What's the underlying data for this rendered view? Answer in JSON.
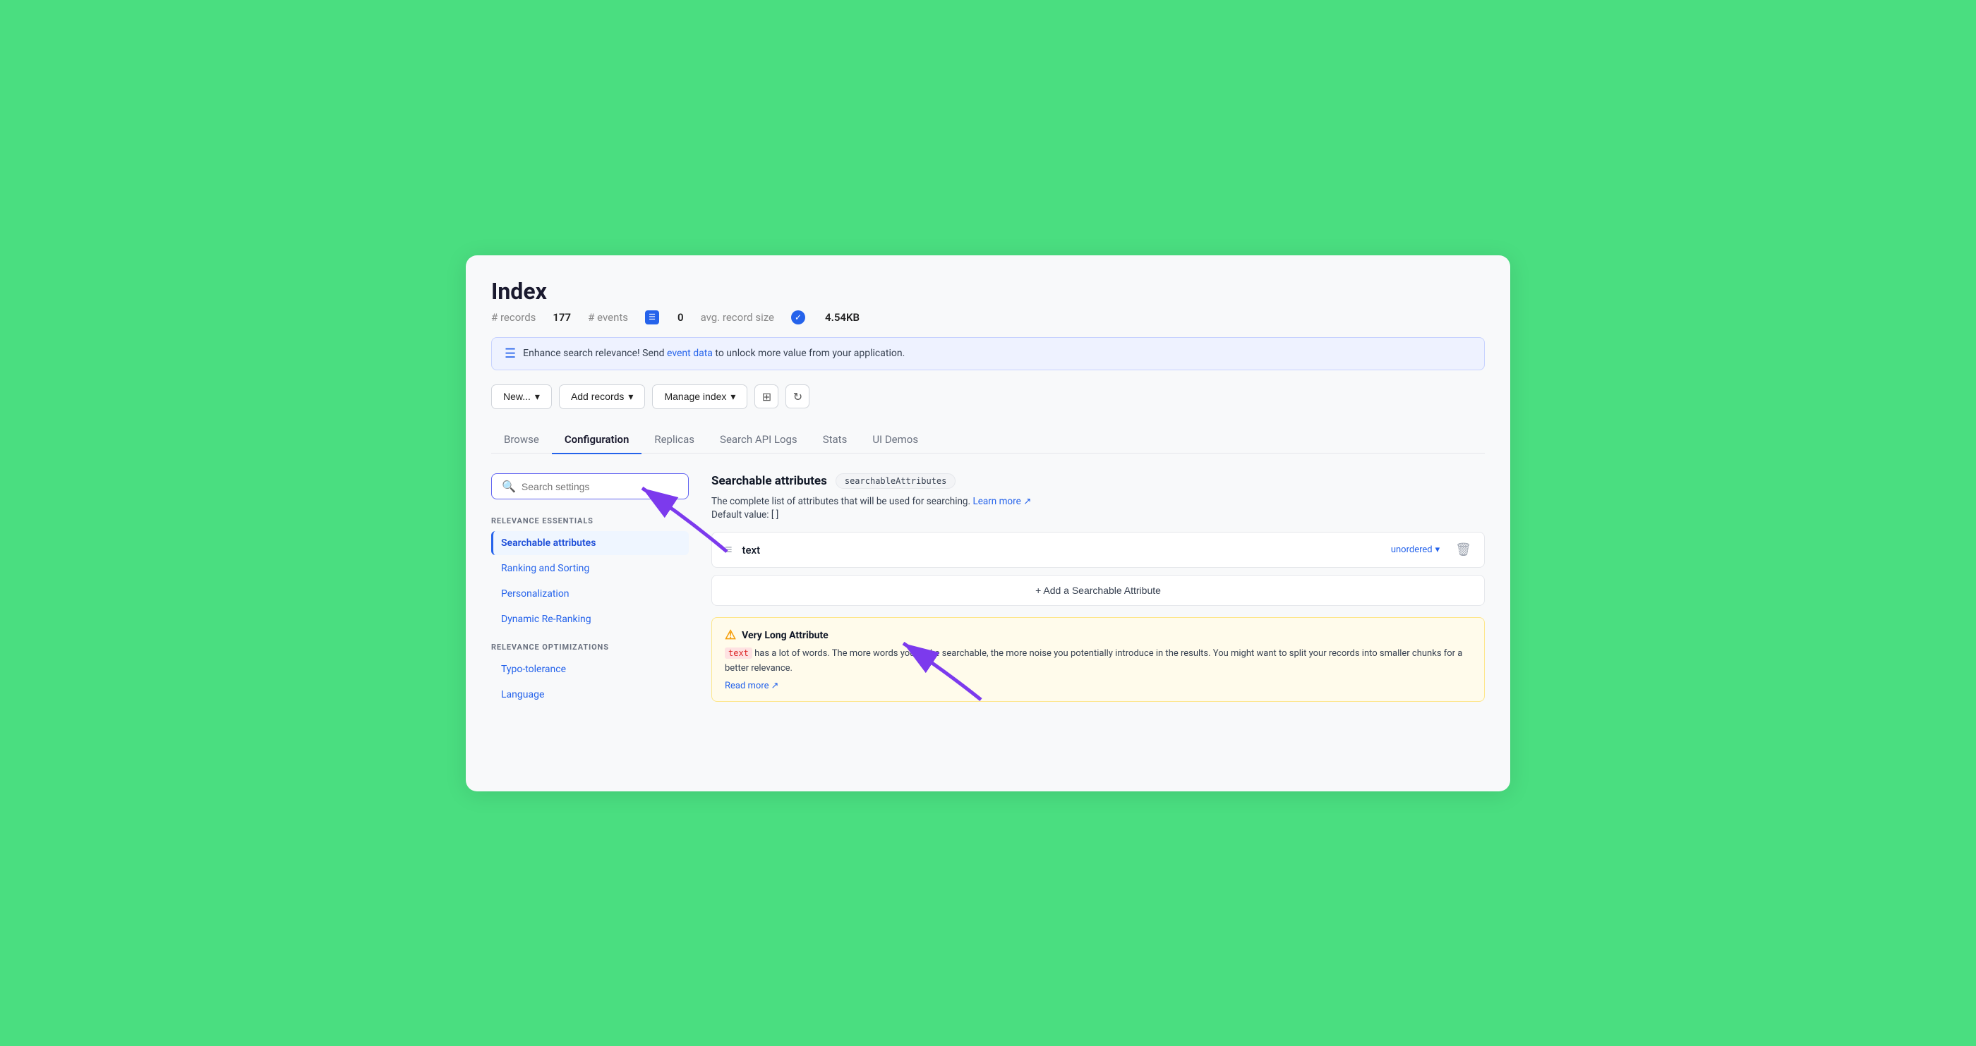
{
  "page": {
    "title": "Index"
  },
  "stats": {
    "records_label": "# records",
    "records_value": "177",
    "events_label": "# events",
    "events_value": "0",
    "avg_label": "avg. record size",
    "avg_value": "4.54KB"
  },
  "banner": {
    "text": "Enhance search relevance! Send ",
    "link_text": "event data",
    "text2": " to unlock more value from your application."
  },
  "toolbar": {
    "new_label": "New...",
    "add_records_label": "Add records",
    "manage_index_label": "Manage index"
  },
  "tabs": [
    {
      "label": "Browse",
      "active": false
    },
    {
      "label": "Configuration",
      "active": true
    },
    {
      "label": "Replicas",
      "active": false
    },
    {
      "label": "Search API Logs",
      "active": false
    },
    {
      "label": "Stats",
      "active": false
    },
    {
      "label": "UI Demos",
      "active": false
    }
  ],
  "sidebar": {
    "search_placeholder": "Search settings",
    "sections": [
      {
        "label": "RELEVANCE ESSENTIALS",
        "items": [
          {
            "label": "Searchable attributes",
            "active": true
          },
          {
            "label": "Ranking and Sorting",
            "active": false
          },
          {
            "label": "Personalization",
            "active": false
          },
          {
            "label": "Dynamic Re-Ranking",
            "active": false
          }
        ]
      },
      {
        "label": "RELEVANCE OPTIMIZATIONS",
        "items": [
          {
            "label": "Typo-tolerance",
            "active": false
          },
          {
            "label": "Language",
            "active": false
          }
        ]
      }
    ]
  },
  "content": {
    "section_title": "Searchable attributes",
    "badge": "searchableAttributes",
    "description": "The complete list of attributes that will be used for searching.",
    "learn_more": "Learn more",
    "default_value": "Default value: [ ]",
    "attribute": {
      "name": "text",
      "order": "unordered"
    },
    "add_button": "+ Add a Searchable Attribute",
    "warning": {
      "title": "Very Long Attribute",
      "code": "text",
      "text1": " has a lot of words. The more words you make searchable, the more noise you potentially introduce in the results. You might want to split your records into smaller chunks for a better relevance.",
      "read_more": "Read more"
    }
  }
}
